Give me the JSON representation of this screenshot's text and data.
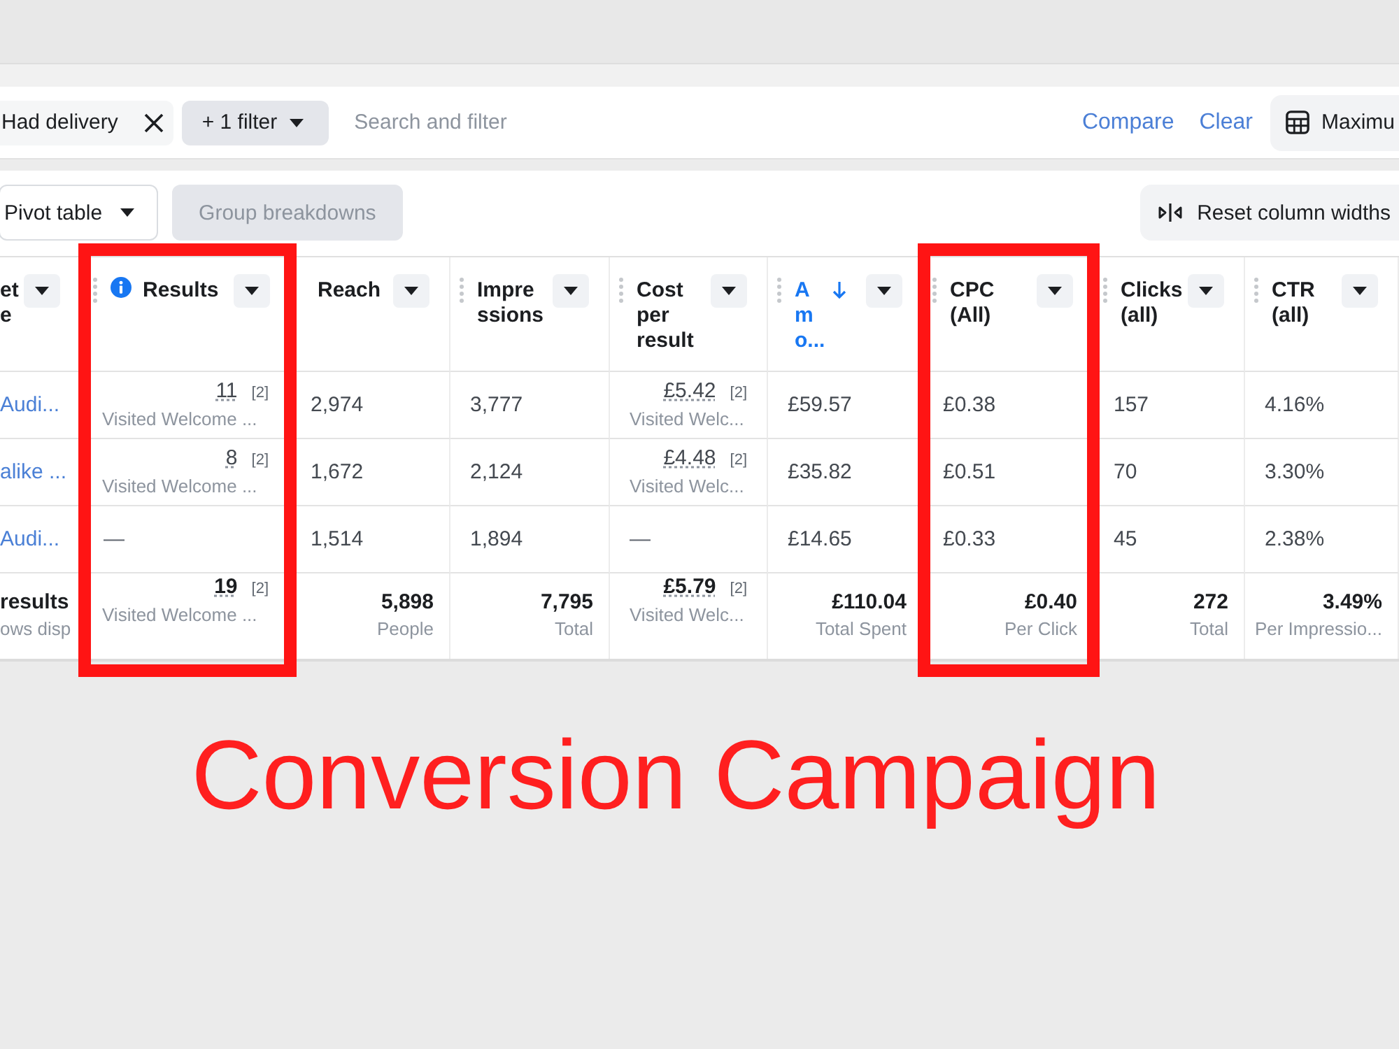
{
  "filter_bar": {
    "chips": [
      {
        "kind": "removable",
        "label": "Had delivery"
      },
      {
        "kind": "dropdown",
        "label": "+ 1 filter"
      }
    ],
    "search": {
      "placeholder": "Search and filter"
    },
    "links": [
      "Compare",
      "Clear"
    ],
    "view_button": {
      "label": "Maximu"
    }
  },
  "toolbar": {
    "buttons": [
      {
        "kind": "dropdown",
        "label": "Pivot table",
        "disabled": false
      },
      {
        "kind": "plain",
        "label": "Group breakdowns",
        "disabled": true
      }
    ],
    "reset_button": {
      "label": "Reset column widths"
    }
  },
  "table": {
    "columns": [
      {
        "lines": [
          "et",
          "e"
        ],
        "handle": false,
        "info": false,
        "sorted": false,
        "highlighted": false
      },
      {
        "lines": [
          "Results"
        ],
        "handle": true,
        "info": true,
        "sorted": false,
        "highlighted": true
      },
      {
        "lines": [
          "Reach"
        ],
        "handle": false,
        "info": false,
        "sorted": false,
        "highlighted": false
      },
      {
        "lines": [
          "Impre",
          "ssions"
        ],
        "handle": true,
        "info": false,
        "sorted": false,
        "highlighted": false
      },
      {
        "lines": [
          "Cost",
          "per",
          "result"
        ],
        "handle": true,
        "info": false,
        "sorted": false,
        "highlighted": false
      },
      {
        "lines": [
          "A",
          "m",
          "o..."
        ],
        "handle": true,
        "info": false,
        "sorted": true,
        "highlighted": false
      },
      {
        "lines": [
          "CPC",
          "(All)"
        ],
        "handle": true,
        "info": false,
        "sorted": false,
        "highlighted": true
      },
      {
        "lines": [
          "Clicks",
          "(all)"
        ],
        "handle": true,
        "info": false,
        "sorted": false,
        "highlighted": false
      },
      {
        "lines": [
          "CTR",
          "(all)"
        ],
        "handle": true,
        "info": false,
        "sorted": false,
        "highlighted": false
      }
    ],
    "rows": [
      {
        "cells": [
          {
            "kind": "link",
            "text": "Audi..."
          },
          {
            "kind": "metric",
            "text": "11",
            "note": "[2]",
            "detail": "Visited Welcome ..."
          },
          {
            "kind": "plain",
            "text": "2,974"
          },
          {
            "kind": "plain",
            "text": "3,777"
          },
          {
            "kind": "metric",
            "text": "£5.42",
            "note": "[2]",
            "detail": "Visited Welc..."
          },
          {
            "kind": "plain",
            "text": "£59.57"
          },
          {
            "kind": "plain",
            "text": "£0.38"
          },
          {
            "kind": "plain",
            "text": "157"
          },
          {
            "kind": "plain",
            "text": "4.16%"
          }
        ]
      },
      {
        "cells": [
          {
            "kind": "link",
            "text": "alike ..."
          },
          {
            "kind": "metric",
            "text": "8",
            "note": "[2]",
            "detail": "Visited Welcome ..."
          },
          {
            "kind": "plain",
            "text": "1,672"
          },
          {
            "kind": "plain",
            "text": "2,124"
          },
          {
            "kind": "metric",
            "text": "£4.48",
            "note": "[2]",
            "detail": "Visited Welc..."
          },
          {
            "kind": "plain",
            "text": "£35.82"
          },
          {
            "kind": "plain",
            "text": "£0.51"
          },
          {
            "kind": "plain",
            "text": "70"
          },
          {
            "kind": "plain",
            "text": "3.30%"
          }
        ]
      },
      {
        "cells": [
          {
            "kind": "link",
            "text": "Audi..."
          },
          {
            "kind": "dash",
            "text": "—"
          },
          {
            "kind": "plain",
            "text": "1,514"
          },
          {
            "kind": "plain",
            "text": "1,894"
          },
          {
            "kind": "dash",
            "text": "—"
          },
          {
            "kind": "plain",
            "text": "£14.65"
          },
          {
            "kind": "plain",
            "text": "£0.33"
          },
          {
            "kind": "plain",
            "text": "45"
          },
          {
            "kind": "plain",
            "text": "2.38%"
          }
        ]
      }
    ],
    "totals": [
      {
        "kind": "label",
        "text": "results",
        "detail": "ows disp"
      },
      {
        "kind": "metric",
        "text": "19",
        "note": "[2]",
        "detail": "Visited Welcome ..."
      },
      {
        "kind": "total",
        "text": "5,898",
        "detail": "People"
      },
      {
        "kind": "total",
        "text": "7,795",
        "detail": "Total"
      },
      {
        "kind": "metric",
        "text": "£5.79",
        "note": "[2]",
        "detail": "Visited Welc..."
      },
      {
        "kind": "total",
        "text": "£110.04",
        "detail": "Total Spent"
      },
      {
        "kind": "total",
        "text": "£0.40",
        "detail": "Per Click"
      },
      {
        "kind": "total",
        "text": "272",
        "detail": "Total"
      },
      {
        "kind": "total",
        "text": "3.49%",
        "detail": "Per Impressio..."
      }
    ]
  },
  "caption": "Conversion Campaign"
}
